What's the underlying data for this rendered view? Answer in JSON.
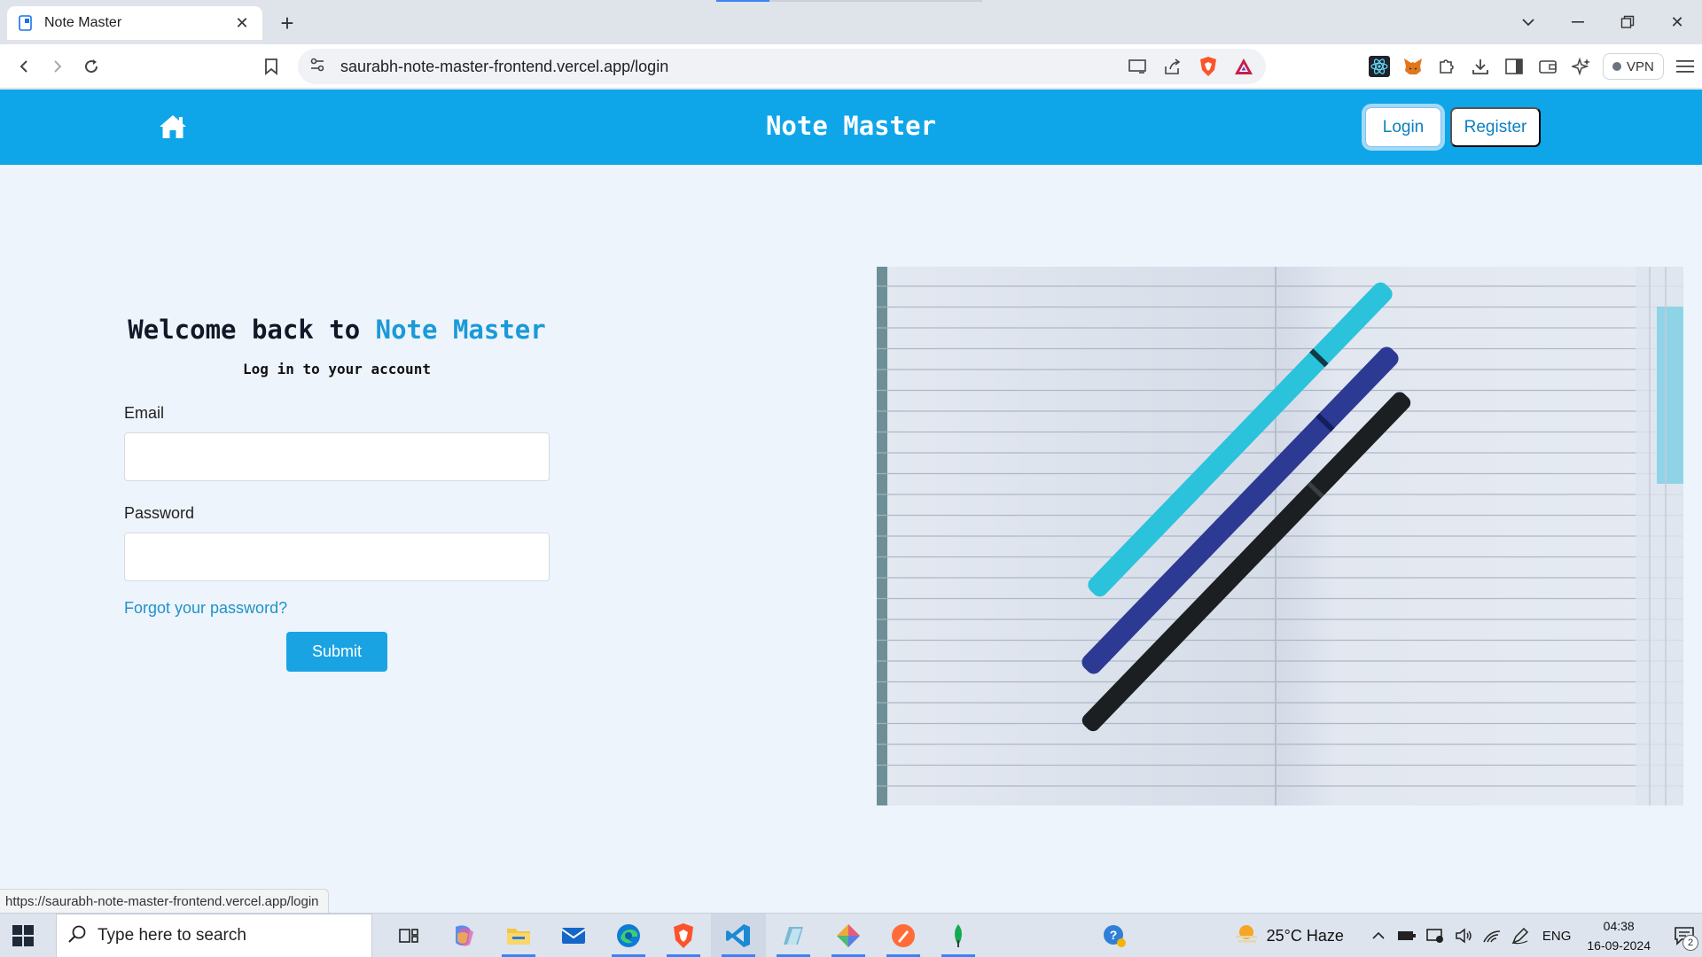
{
  "browser": {
    "tab_title": "Note Master",
    "url": "saurabh-note-master-frontend.vercel.app/login",
    "vpn_label": "VPN",
    "status_url": "https://saurabh-note-master-frontend.vercel.app/login"
  },
  "header": {
    "brand": "Note Master",
    "login_label": "Login",
    "register_label": "Register"
  },
  "login": {
    "welcome_prefix": "Welcome back to ",
    "welcome_accent": "Note Master",
    "subtitle": "Log in to your account",
    "email_label": "Email",
    "email_value": "",
    "password_label": "Password",
    "password_value": "",
    "forgot_label": "Forgot your password?",
    "submit_label": "Submit"
  },
  "taskbar": {
    "search_placeholder": "Type here to search",
    "weather": "25°C  Haze",
    "language": "ENG",
    "time": "04:38",
    "date": "16-09-2024",
    "notification_count": "2"
  },
  "colors": {
    "header_bg": "#0ea5e9",
    "accent": "#1a9ad8",
    "page_bg": "#eef4fb"
  }
}
